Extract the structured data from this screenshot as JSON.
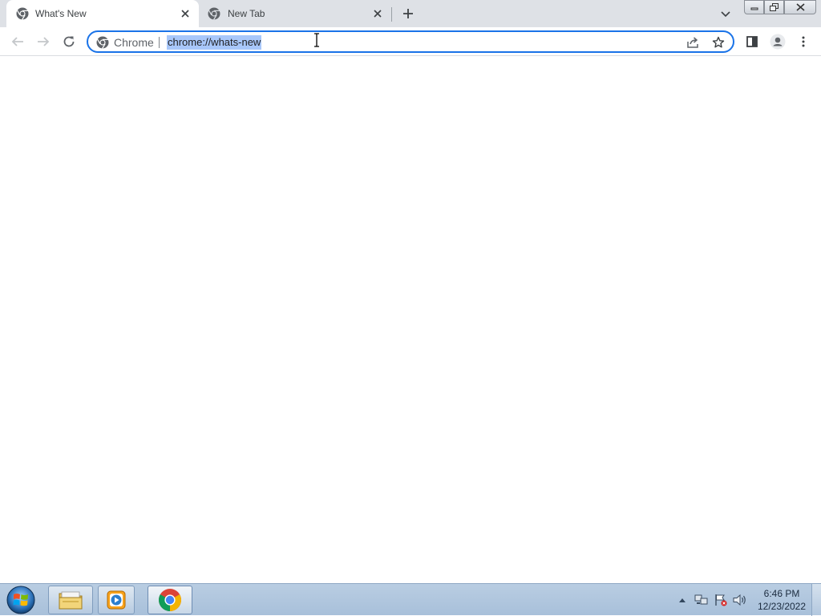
{
  "browser": {
    "tabs": [
      {
        "title": "What's New",
        "icon": "chrome-icon",
        "active": true
      },
      {
        "title": "New Tab",
        "icon": "chrome-icon",
        "active": false
      }
    ],
    "new_tab_icon": "plus-icon",
    "tab_search_icon": "chevron-down-icon",
    "window_controls": [
      "minimize",
      "maximize",
      "close"
    ],
    "toolbar": {
      "back_icon": "arrow-left-icon",
      "forward_icon": "arrow-right-icon",
      "reload_icon": "reload-icon",
      "side_panel_icon": "side-panel-icon",
      "profile_icon": "profile-icon",
      "menu_icon": "kebab-menu-icon"
    },
    "omnibox": {
      "chip_label": "Chrome",
      "url": "chrome://whats-new",
      "url_selected": true,
      "share_icon": "share-icon",
      "bookmark_icon": "star-icon",
      "focus_color": "#1a73e8"
    }
  },
  "taskbar": {
    "start_icon": "windows-start-icon",
    "apps": [
      {
        "name": "Windows Explorer",
        "icon": "folder-icon"
      },
      {
        "name": "Windows Media Player",
        "icon": "media-player-icon"
      },
      {
        "name": "Google Chrome",
        "icon": "chrome-icon",
        "active": true
      }
    ],
    "tray": {
      "icons": [
        "show-hidden-icons",
        "network-icon",
        "action-center-icon",
        "volume-icon"
      ],
      "time": "6:46 PM",
      "date": "12/23/2022"
    }
  },
  "colors": {
    "tabstrip_bg": "#dee1e6",
    "selection_bg": "#a8c7fa",
    "taskbar_bg": "#b4c9e0"
  }
}
